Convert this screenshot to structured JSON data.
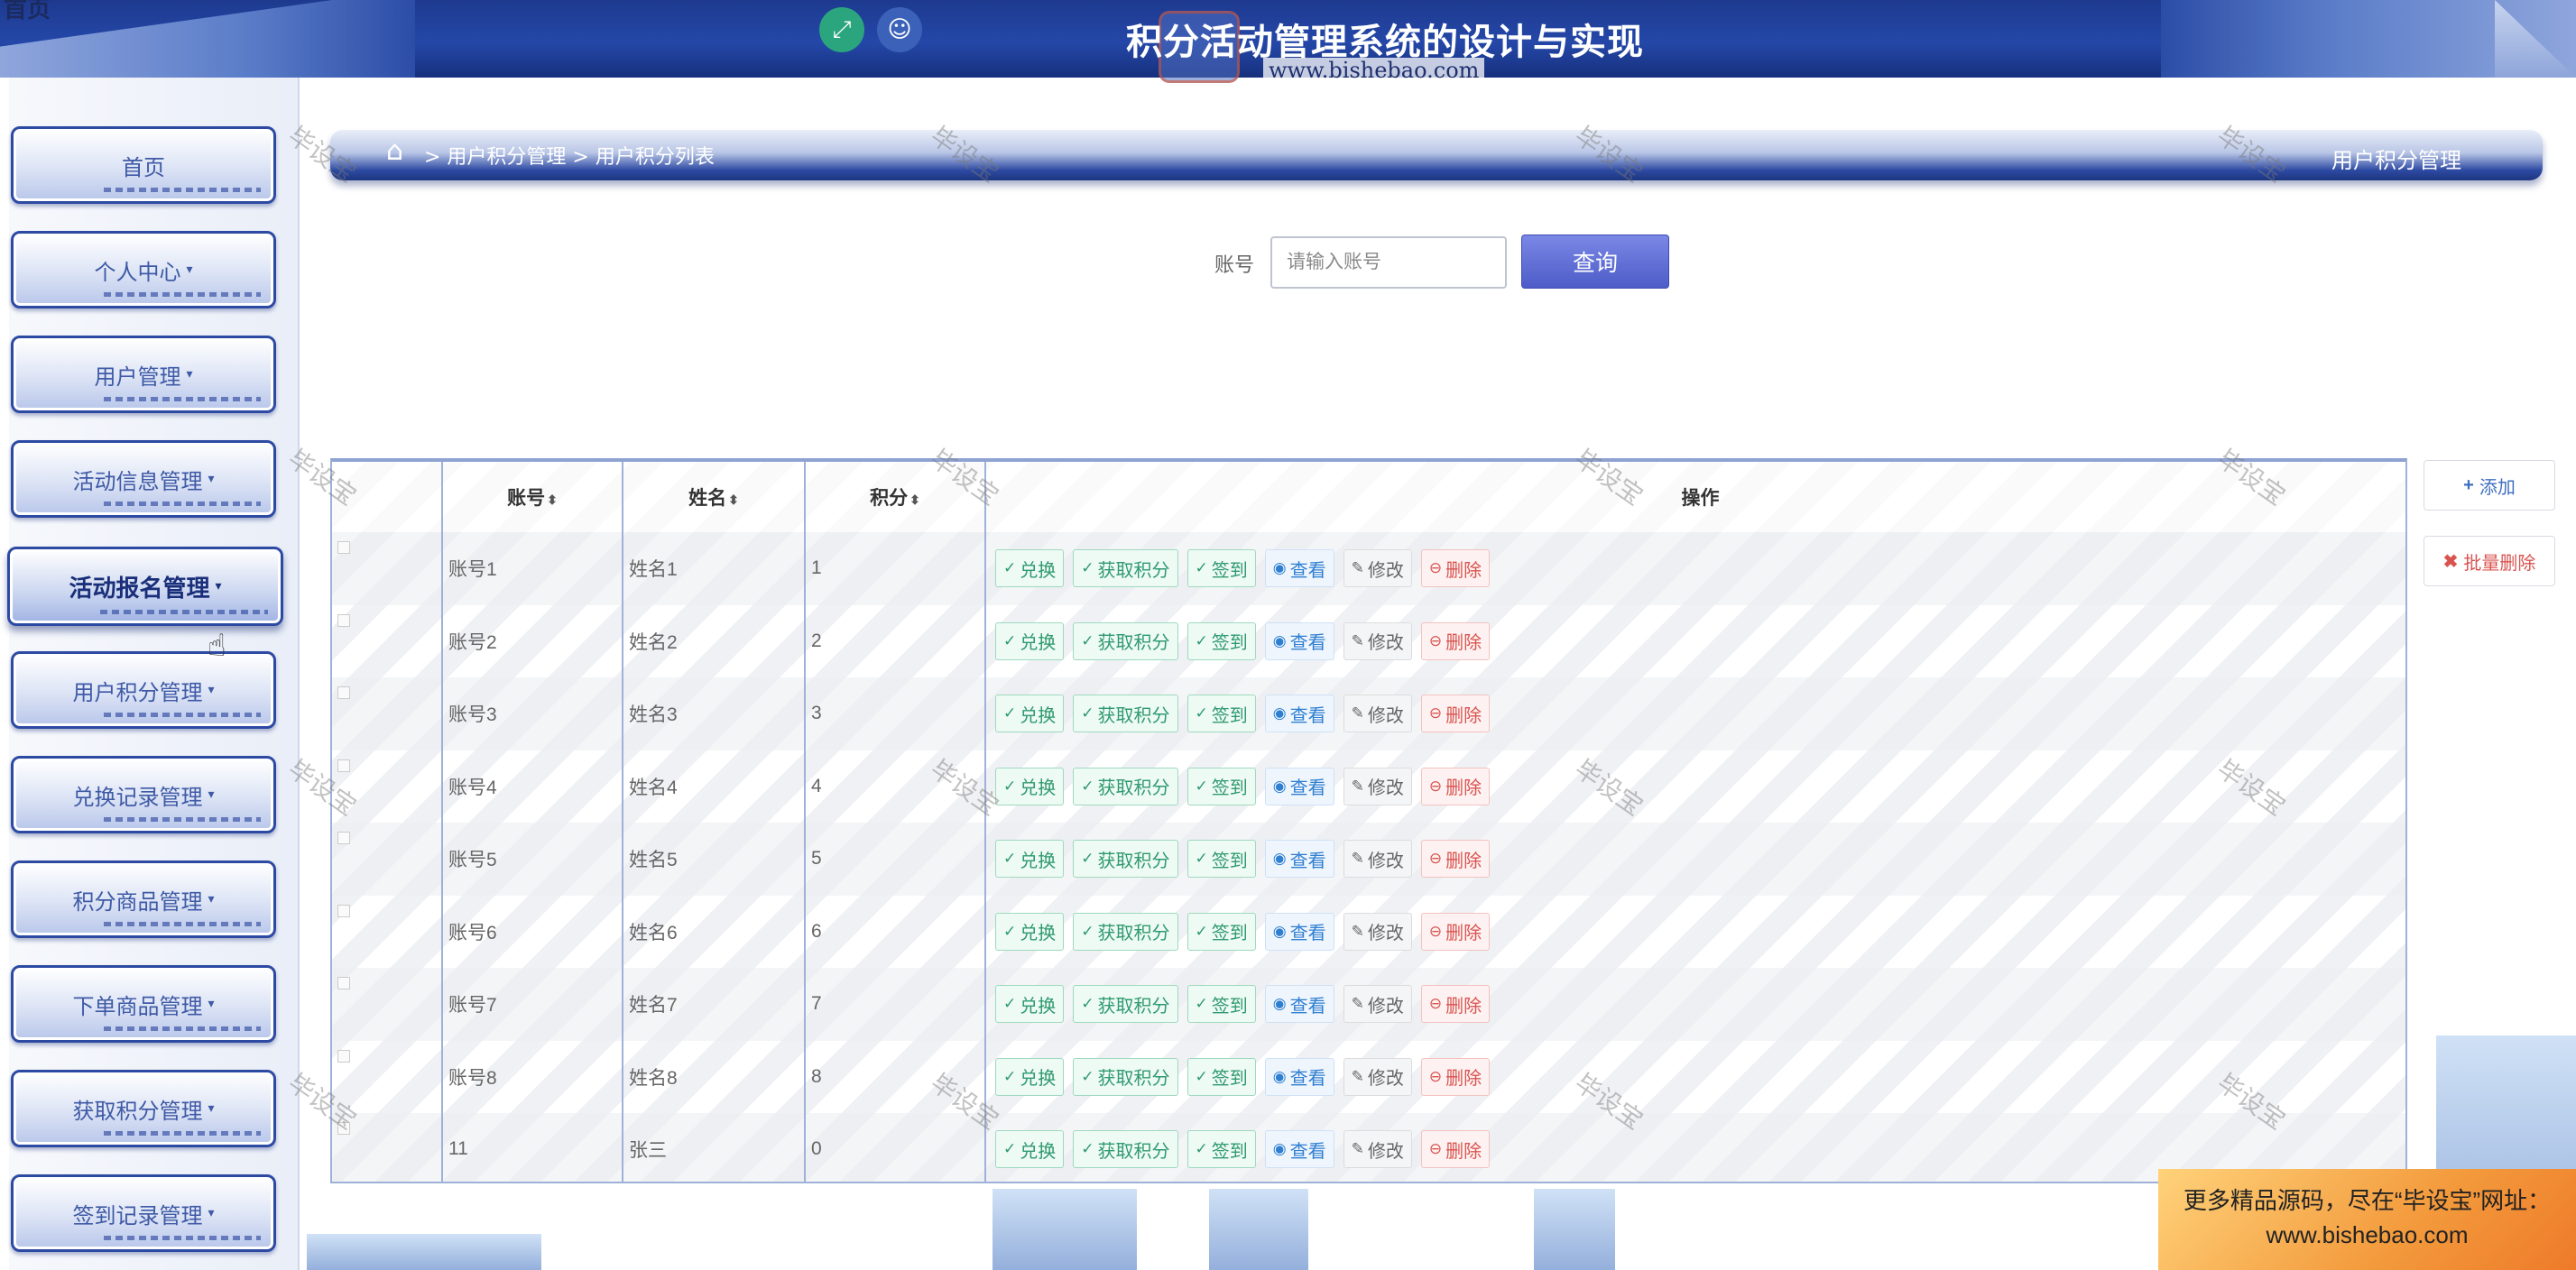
{
  "header": {
    "corner_label": "首页",
    "title": "积分活动管理系统的设计与实现",
    "url_watermark": "www.bishebao.com",
    "fullscreen_icon": "expand-arrows-icon",
    "user_icon": "user-icon"
  },
  "sidebar": {
    "items": [
      {
        "label": "首页",
        "caret": ""
      },
      {
        "label": "个人中心",
        "caret": "▾"
      },
      {
        "label": "用户管理",
        "caret": "▾"
      },
      {
        "label": "活动信息管理",
        "caret": "▾"
      },
      {
        "label": "活动报名管理",
        "caret": "▾"
      },
      {
        "label": "用户积分管理",
        "caret": "▾"
      },
      {
        "label": "兑换记录管理",
        "caret": "▾"
      },
      {
        "label": "积分商品管理",
        "caret": "▾"
      },
      {
        "label": "下单商品管理",
        "caret": "▾"
      },
      {
        "label": "获取积分管理",
        "caret": "▾"
      },
      {
        "label": "签到记录管理",
        "caret": "▾"
      }
    ],
    "active_index": 4
  },
  "breadcrumb": {
    "home_icon": "home-icon",
    "path": "> 用户积分管理 > 用户积分列表",
    "title": "用户积分管理"
  },
  "search": {
    "label": "账号",
    "placeholder": "请输入账号",
    "value": "",
    "button": "查询"
  },
  "table": {
    "columns": [
      "账号",
      "姓名",
      "积分",
      "操作"
    ],
    "sort_icon": "◆",
    "actions": {
      "exchange": "兑换",
      "earn": "获取积分",
      "checkin": "签到",
      "view": "查看",
      "edit": "修改",
      "delete": "删除"
    },
    "rows": [
      {
        "account": "账号1",
        "name": "姓名1",
        "points": "1"
      },
      {
        "account": "账号2",
        "name": "姓名2",
        "points": "2"
      },
      {
        "account": "账号3",
        "name": "姓名3",
        "points": "3"
      },
      {
        "account": "账号4",
        "name": "姓名4",
        "points": "4"
      },
      {
        "account": "账号5",
        "name": "姓名5",
        "points": "5"
      },
      {
        "account": "账号6",
        "name": "姓名6",
        "points": "6"
      },
      {
        "account": "账号7",
        "name": "姓名7",
        "points": "7"
      },
      {
        "account": "账号8",
        "name": "姓名8",
        "points": "8"
      },
      {
        "account": "11",
        "name": "张三",
        "points": "0"
      }
    ]
  },
  "side_buttons": {
    "add": "添加",
    "batch_delete": "批量删除"
  },
  "watermark_text": "毕设宝",
  "promo": {
    "line1": "更多精品源码，尽在“毕设宝”网址：",
    "line2": "www.bishebao.com"
  }
}
